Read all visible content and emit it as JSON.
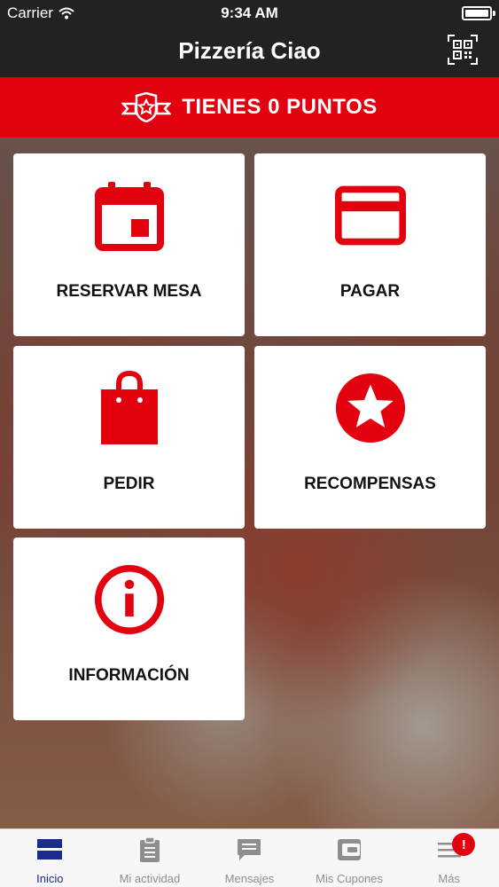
{
  "status_bar": {
    "carrier": "Carrier",
    "time": "9:34 AM"
  },
  "header": {
    "title": "Pizzería Ciao"
  },
  "points_banner": {
    "text": "TIENES 0 PUNTOS"
  },
  "tiles": [
    {
      "label": "RESERVAR MESA",
      "icon": "calendar-icon"
    },
    {
      "label": "PAGAR",
      "icon": "credit-card-icon"
    },
    {
      "label": "PEDIR",
      "icon": "shopping-bag-icon"
    },
    {
      "label": "RECOMPENSAS",
      "icon": "star-icon"
    },
    {
      "label": "INFORMACIÓN",
      "icon": "info-icon"
    }
  ],
  "tab_bar": {
    "tabs": [
      {
        "label": "Inicio",
        "icon": "home-grid-icon",
        "active": true
      },
      {
        "label": "Mi actividad",
        "icon": "clipboard-icon"
      },
      {
        "label": "Mensajes",
        "icon": "message-icon"
      },
      {
        "label": "Mis Cupones",
        "icon": "wallet-icon"
      },
      {
        "label": "Más",
        "icon": "menu-icon",
        "badge": "!"
      }
    ]
  },
  "colors": {
    "accent": "#e3000f",
    "dark": "#222222",
    "active_tab": "#1b2a8c",
    "inactive_tab": "#8e8e8e"
  }
}
